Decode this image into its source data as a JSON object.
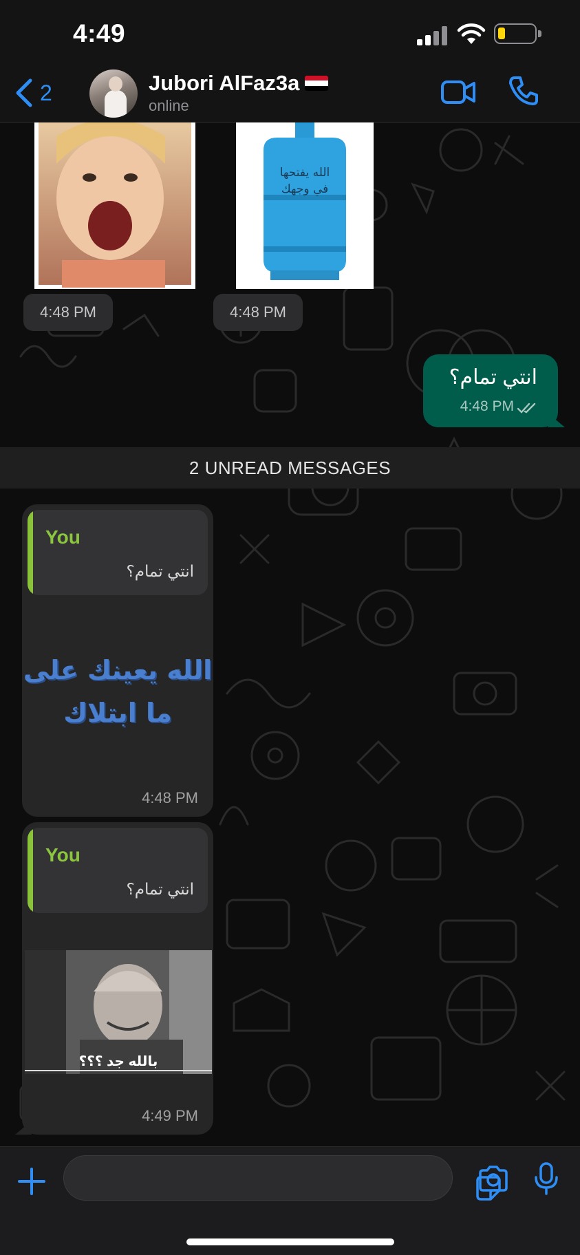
{
  "status_bar": {
    "time": "4:49"
  },
  "header": {
    "back_count": "2",
    "contact_name": "Jubori AlFaz3a",
    "contact_status": "online",
    "flag_colors": [
      "#ce1126",
      "#ffffff",
      "#000000"
    ],
    "icons": {
      "back": "chevron-left-icon",
      "video": "video-call-icon",
      "call": "phone-icon"
    }
  },
  "messages": {
    "top_images": [
      {
        "kind": "image",
        "description_icon": "laughing-child-photo",
        "time": "4:48 PM"
      },
      {
        "kind": "image",
        "description_icon": "gas-cylinder-photo",
        "time": "4:48 PM",
        "overlay_text": "الله يفتحها في وجهك"
      }
    ],
    "outgoing": {
      "text": "انتي تمام؟",
      "time": "4:48 PM",
      "status": "read"
    },
    "unread_divider": "2 UNREAD MESSAGES",
    "incoming": [
      {
        "quote_author": "You",
        "quote_text": "انتي تمام؟",
        "sticker_text_line1": "الله يعينك على",
        "sticker_text_line2": "ما ابتلاك",
        "time": "4:48 PM"
      },
      {
        "quote_author": "You",
        "quote_text": "انتي تمام؟",
        "photo_caption": "بالله جد ؟؟؟",
        "time": "4:49 PM"
      }
    ]
  },
  "input_bar": {
    "placeholder": "",
    "icons": {
      "attach": "plus-icon",
      "sticker": "sticker-icon",
      "camera": "camera-icon",
      "voice": "microphone-icon"
    }
  },
  "colors": {
    "accent": "#2f8ef6",
    "outgoing_bubble": "#005c4b",
    "incoming_bubble": "#262626",
    "quote_bar": "#8ac23a",
    "quote_author": "#8cc63f"
  }
}
